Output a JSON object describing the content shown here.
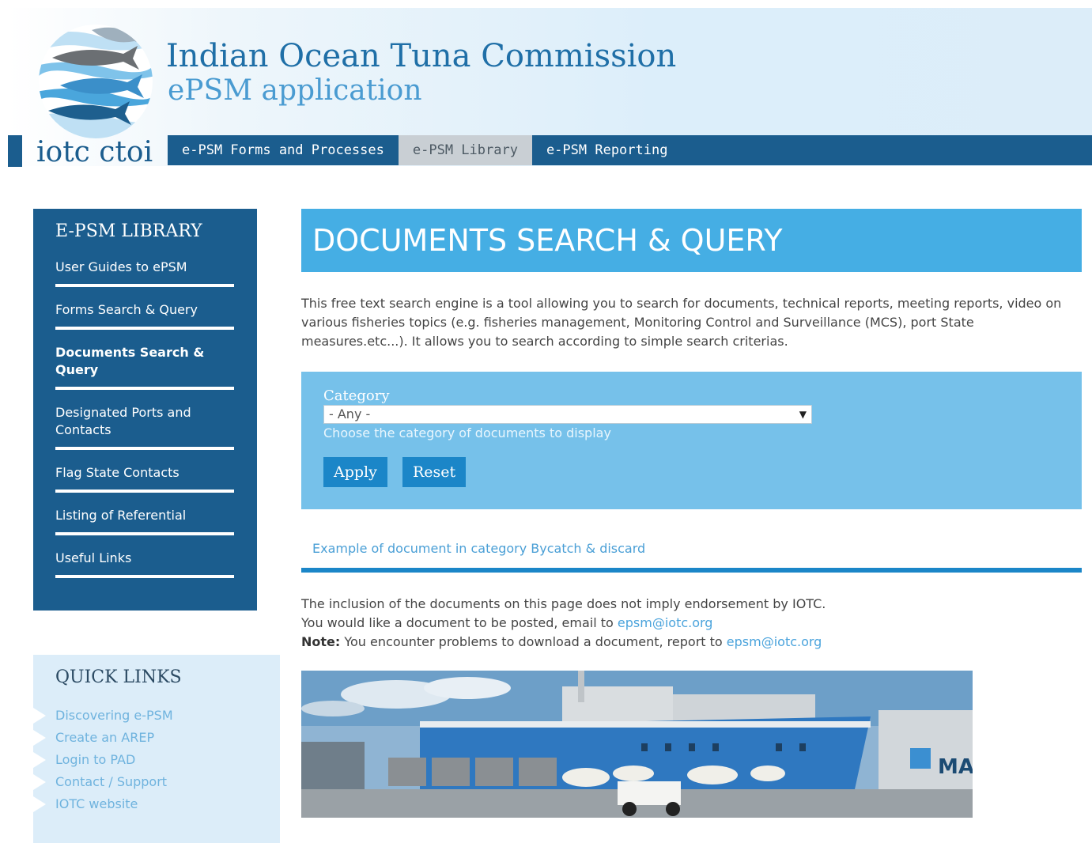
{
  "header": {
    "org_title": "Indian Ocean Tuna Commission",
    "app_title": "ePSM application",
    "logo_word": "iotc ctoi"
  },
  "nav": {
    "items": [
      {
        "label": "e-PSM Forms and Processes",
        "active": false
      },
      {
        "label": "e-PSM Library",
        "active": true
      },
      {
        "label": "e-PSM Reporting",
        "active": false
      }
    ]
  },
  "sidebar": {
    "title": "E-PSM LIBRARY",
    "items": [
      {
        "label": "User Guides to ePSM"
      },
      {
        "label": "Forms Search & Query"
      },
      {
        "label": "Documents Search & Query",
        "active": true
      },
      {
        "label": "Designated Ports and Contacts"
      },
      {
        "label": "Flag State Contacts"
      },
      {
        "label": "Listing of Referential"
      },
      {
        "label": "Useful Links"
      }
    ]
  },
  "quick_links": {
    "title": "QUICK LINKS",
    "items": [
      "Discovering e-PSM",
      "Create an AREP",
      "Login to PAD",
      "Contact / Support",
      "IOTC website"
    ]
  },
  "main": {
    "title": "DOCUMENTS SEARCH & QUERY",
    "intro": "This free text search engine is a tool allowing you to search for documents, technical reports, meeting reports, video on various fisheries topics (e.g. fisheries management, Monitoring Control and Surveillance (MCS), port State measures.etc...). It allows you to search according to simple search criterias.",
    "filter": {
      "label": "Category",
      "selected": "- Any -",
      "help": "Choose the category of documents to display",
      "apply_label": "Apply",
      "reset_label": "Reset"
    },
    "example_link": "Example of document in category Bycatch & discard",
    "notes": {
      "line1": "The inclusion of the documents on this page does not imply endorsement by IOTC.",
      "line2_text": "You would like a document to be posted, email to ",
      "line2_email": "epsm@iotc.org",
      "line3_bold": "Note:",
      "line3_text": " You encounter problems to download a document, report to ",
      "line3_email": "epsm@iotc.org"
    },
    "photo_text": "MAE"
  },
  "colors": {
    "navy": "#1b5d8e",
    "title_blue": "#45aee4",
    "filter_blue": "#76c1ea",
    "button_blue": "#1b86c8",
    "link_blue": "#4a9fd6"
  }
}
